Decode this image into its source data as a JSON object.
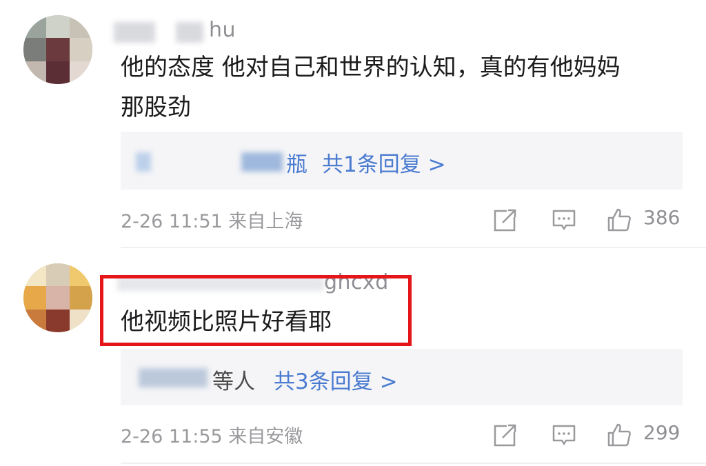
{
  "comments": [
    {
      "username_visible": "hu",
      "text_line1": "他的态度 他对自己和世界的认知，真的有他妈妈",
      "text_line2": "那股劲",
      "reply_prefix_visible": "瓶",
      "reply_link": "共1条回复 >",
      "meta": "2-26 11:51 来自上海",
      "likes": "386"
    },
    {
      "username_visible": "ghcxd",
      "text_line1": "他视频比照片好看耶",
      "reply_prefix_visible": "等人",
      "reply_link": "共3条回复 >",
      "meta": "2-26 11:55 来自安徽",
      "likes": "299"
    }
  ],
  "icons": {
    "share": "share-icon",
    "comment": "comment-icon",
    "like": "thumbs-up-icon"
  },
  "colors": {
    "link": "#4a7bd0",
    "highlight_border": "#e5161a"
  }
}
